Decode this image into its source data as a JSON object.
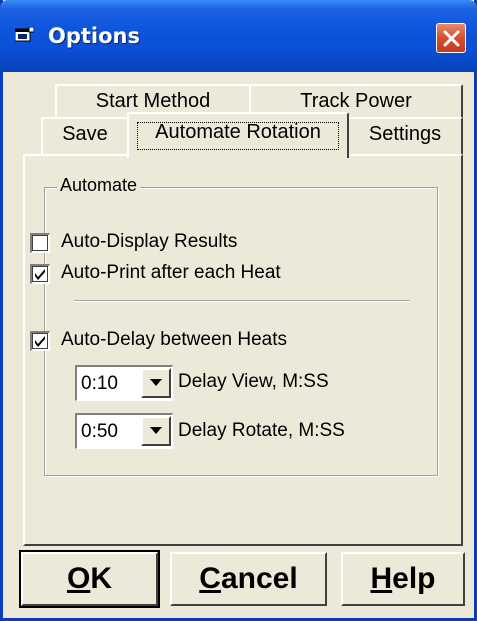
{
  "window": {
    "title": "Options",
    "close_icon": "close-icon"
  },
  "tabs": {
    "row_back": [
      {
        "label": "Start Method"
      },
      {
        "label": "Track Power"
      }
    ],
    "row_front": [
      {
        "label": "Save"
      },
      {
        "label": "Automate Rotation",
        "selected": true
      },
      {
        "label": "Settings"
      }
    ]
  },
  "automate": {
    "group_label": "Automate",
    "auto_display": {
      "label": "Auto-Display Results",
      "checked": false
    },
    "auto_print": {
      "label": "Auto-Print after each Heat",
      "checked": true
    },
    "auto_delay": {
      "label": "Auto-Delay between Heats",
      "checked": true
    },
    "delay_view": {
      "value": "0:10",
      "label": "Delay View, M:SS"
    },
    "delay_rotate": {
      "value": "0:50",
      "label": "Delay Rotate, M:SS"
    }
  },
  "buttons": {
    "ok_mnemonic": "O",
    "ok_rest": "K",
    "cancel_mnemonic": "C",
    "cancel_rest": "ancel",
    "help_mnemonic": "H",
    "help_rest": "elp"
  },
  "colors": {
    "title_bar": "#0B4FD6",
    "dialog_bg": "#ECE9D8",
    "close_button": "#D4502F"
  }
}
